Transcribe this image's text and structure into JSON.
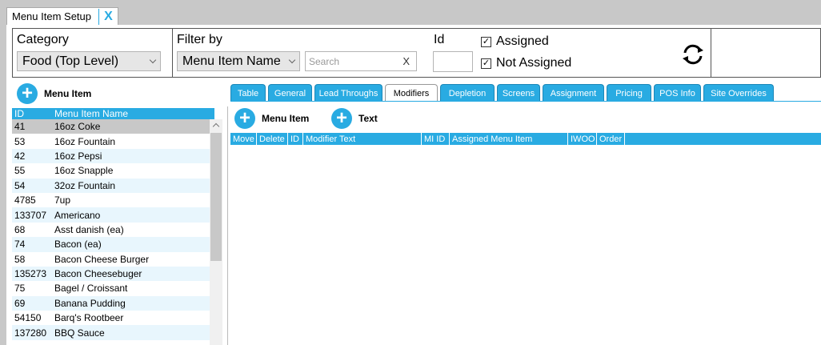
{
  "window": {
    "title": "Menu Item Setup",
    "close_label": "X"
  },
  "filters": {
    "category_label": "Category",
    "category_value": "Food (Top Level)",
    "filter_by_label": "Filter by",
    "filter_by_value": "Menu Item Name",
    "search_placeholder": "Search",
    "search_clear": "X",
    "id_label": "Id",
    "assigned_label": "Assigned",
    "assigned_checked": true,
    "not_assigned_label": "Not Assigned",
    "not_assigned_checked": true,
    "check_mark": "✓"
  },
  "left_panel": {
    "add_label": "Menu Item",
    "plus": "+",
    "columns": {
      "id": "ID",
      "name": "Menu Item Name"
    },
    "rows": [
      {
        "id": "41",
        "name": "16oz Coke"
      },
      {
        "id": "53",
        "name": "16oz Fountain"
      },
      {
        "id": "42",
        "name": "16oz Pepsi"
      },
      {
        "id": "55",
        "name": "16oz Snapple"
      },
      {
        "id": "54",
        "name": "32oz Fountain"
      },
      {
        "id": "4785",
        "name": "7up"
      },
      {
        "id": "133707",
        "name": "Americano"
      },
      {
        "id": "68",
        "name": "Asst danish (ea)"
      },
      {
        "id": "74",
        "name": "Bacon (ea)"
      },
      {
        "id": "58",
        "name": "Bacon Cheese Burger"
      },
      {
        "id": "135273",
        "name": "Bacon Cheesebuger"
      },
      {
        "id": "75",
        "name": "Bagel / Croissant"
      },
      {
        "id": "69",
        "name": "Banana Pudding"
      },
      {
        "id": "54150",
        "name": "Barq's Rootbeer"
      },
      {
        "id": "137280",
        "name": "BBQ Sauce"
      }
    ]
  },
  "tabs": [
    "Table",
    "General",
    "Lead Throughs",
    "Modifiers",
    "Depletion",
    "Screens",
    "Assignment",
    "Pricing",
    "POS Info",
    "Site Overrides"
  ],
  "active_tab": "Modifiers",
  "modifiers": {
    "add_menu_item_label": "Menu Item",
    "add_text_label": "Text",
    "columns": [
      "Move",
      "Delete",
      "ID",
      "Modifier Text",
      "MI ID",
      "Assigned Menu Item",
      "IWOO",
      "Order"
    ]
  },
  "colors": {
    "accent": "#29abe2",
    "selected_row": "#c8c8c8",
    "alt_row": "#e8f6fd"
  }
}
